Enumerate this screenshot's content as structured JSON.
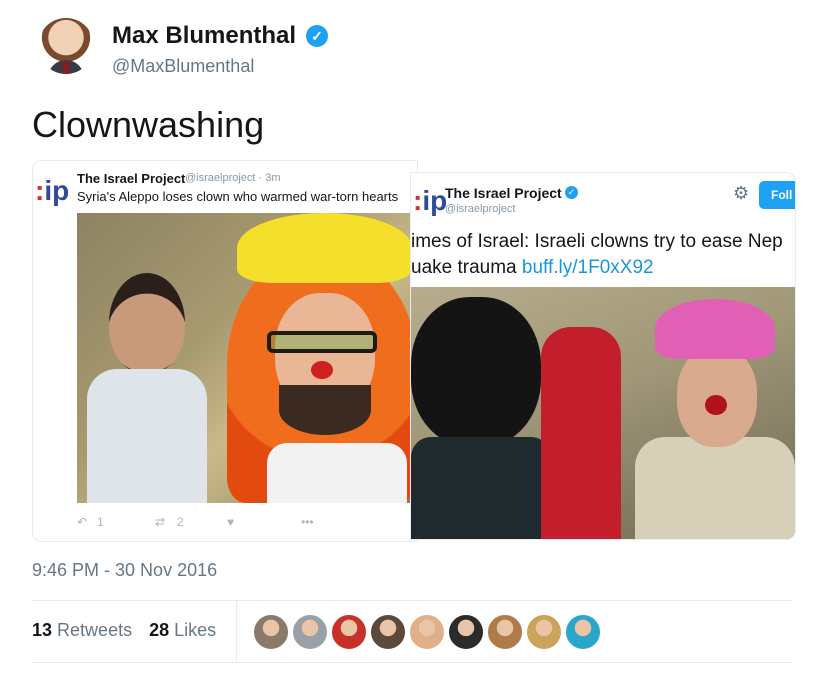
{
  "author": {
    "name": "Max Blumenthal",
    "handle": "@MaxBlumenthal",
    "verified": true
  },
  "tweet": {
    "text": "Clownwashing"
  },
  "embedded_left": {
    "logo_text": "ip",
    "name": "The Israel Project",
    "handle_time": "@israelproject · 3m",
    "text": "Syria's Aleppo loses clown who warmed war-torn hearts",
    "actions": {
      "reply_count": "1",
      "retweet_count": "2",
      "more": "•••"
    }
  },
  "embedded_right": {
    "logo_text": "ip",
    "name": "The Israel Project",
    "handle": "@israelproject",
    "follow_label": "Foll",
    "text_line1": "imes of Israel: Israeli clowns try to ease Nep",
    "text_line2_prefix": "uake trauma ",
    "text_link": "buff.ly/1F0xX92"
  },
  "timestamp": "9:46 PM - 30 Nov 2016",
  "stats": {
    "retweets_count": "13",
    "retweets_label": "Retweets",
    "likes_count": "28",
    "likes_label": "Likes"
  },
  "liker_avatars": [
    "#8a7a6a",
    "#9aa0a8",
    "#c8302a",
    "#5b4a3a",
    "#e0b08a",
    "#2b2b2b",
    "#b07a4a",
    "#c9a45a",
    "#2aa6c8"
  ],
  "colors": {
    "link": "#1b95e0",
    "verified": "#1da1f2",
    "secondary_text": "#657786"
  }
}
